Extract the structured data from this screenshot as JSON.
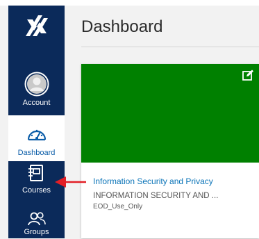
{
  "header": {
    "title": "Dashboard"
  },
  "sidebar": {
    "items": [
      {
        "label": "Account",
        "icon": "account-icon"
      },
      {
        "label": "Dashboard",
        "icon": "dashboard-icon",
        "active": true
      },
      {
        "label": "Courses",
        "icon": "courses-icon"
      },
      {
        "label": "Groups",
        "icon": "groups-icon"
      }
    ],
    "colors": {
      "background": "#0b2a5a",
      "active_background": "#ffffff",
      "active_text": "#0b5da8"
    }
  },
  "course_card": {
    "title": "Information Security and Privacy",
    "code": "INFORMATION SECURITY AND ...",
    "term": "EOD_Use_Only",
    "hero_color": "#008000",
    "edit_icon": "edit-icon"
  },
  "annotation": {
    "icon": "red-arrow-icon",
    "color": "#e21f26"
  }
}
